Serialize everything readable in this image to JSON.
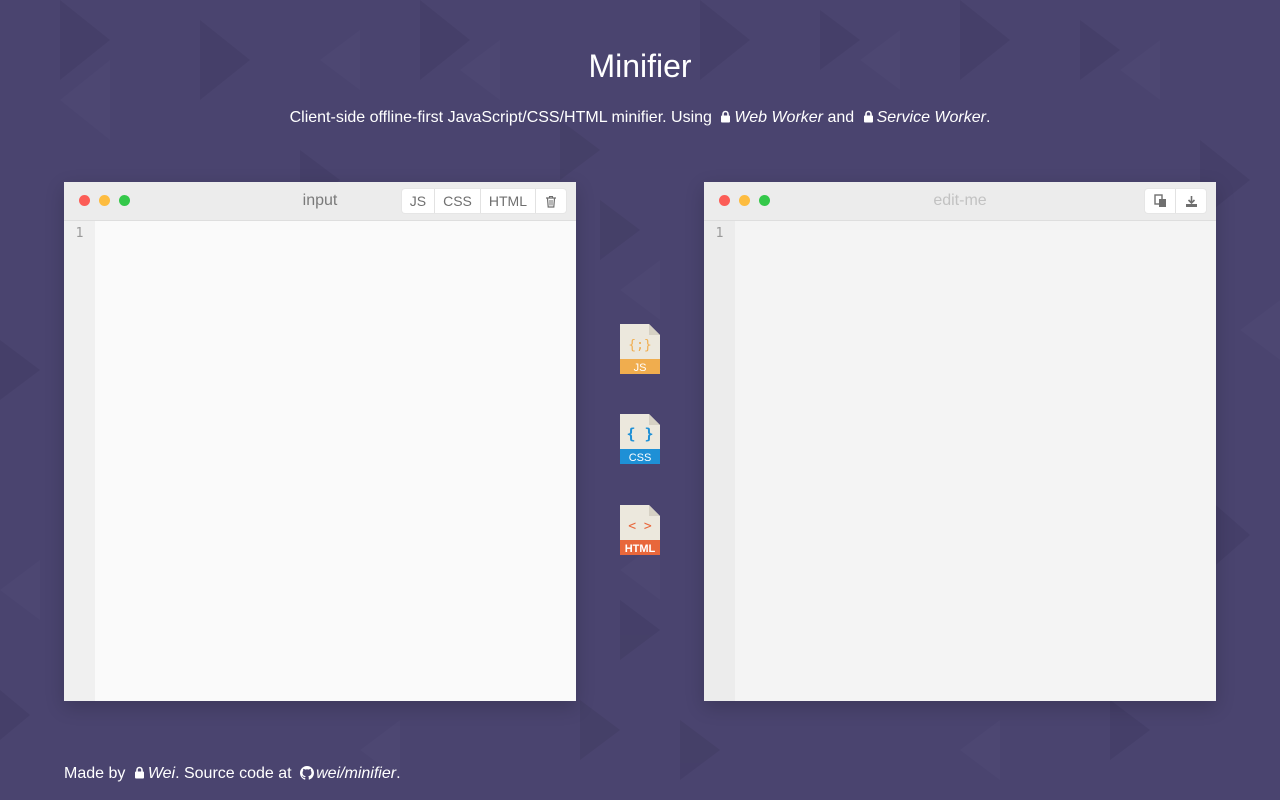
{
  "page": {
    "title": "Minifier",
    "subtitle": {
      "prefix": "Client-side offline-first JavaScript/CSS/HTML minifier. Using",
      "link1": "Web Worker",
      "middle": "and",
      "link2": "Service Worker",
      "suffix": "."
    }
  },
  "input_editor": {
    "title": "input",
    "buttons": [
      "JS",
      "CSS",
      "HTML"
    ],
    "delete_icon": "trash-icon",
    "line_number": "1"
  },
  "output_editor": {
    "title": "edit-me",
    "copy_icon": "copy-icon",
    "download_icon": "download-icon",
    "line_number": "1"
  },
  "file_icons": {
    "js": {
      "glyph": "{;}",
      "label": "JS",
      "color": "#f0ad4e"
    },
    "css": {
      "glyph": "{ }",
      "label": "CSS",
      "color": "#1e90d6"
    },
    "html": {
      "glyph": "< >",
      "label": "HTML",
      "color": "#e8673b"
    }
  },
  "footer": {
    "made_by": "Made by",
    "author": "Wei",
    "source_text": ". Source code at",
    "repo": "wei/minifier",
    "end": "."
  },
  "colors": {
    "background": "#4a446f",
    "dot_red": "#fc5d57",
    "dot_yellow": "#fdbc40",
    "dot_green": "#34c84a"
  }
}
